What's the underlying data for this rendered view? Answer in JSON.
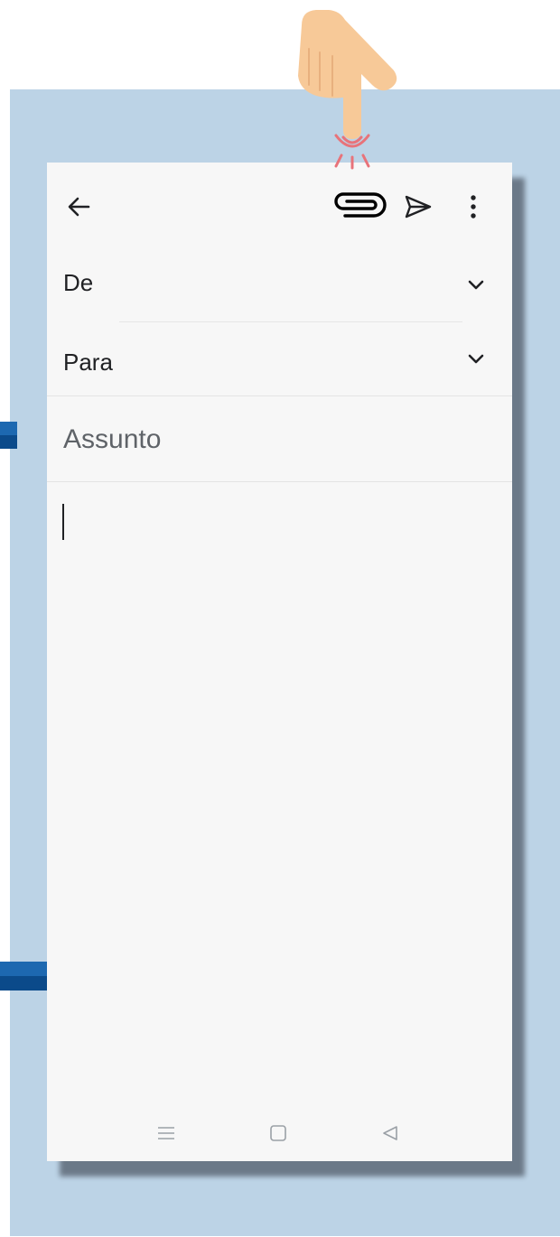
{
  "compose": {
    "from_label": "De",
    "to_label": "Para",
    "subject_placeholder": "Assunto",
    "body_text": ""
  },
  "toolbar": {
    "back_icon": "arrow-left-icon",
    "attach_icon": "paperclip-icon",
    "send_icon": "send-icon",
    "more_icon": "more-vertical-icon"
  },
  "system_nav": {
    "recents_icon": "menu-lines-icon",
    "home_icon": "square-icon",
    "back_icon": "triangle-back-icon"
  },
  "overlay": {
    "hint": "pointing-hand-icon",
    "highlighted_control": "attach"
  },
  "colors": {
    "backdrop": "#bcd3e6",
    "screen": "#f7f7f7",
    "text_primary": "#202124",
    "text_secondary": "#5f6368",
    "tap_highlight": "#e8737a",
    "hand_skin": "#f7c998",
    "edge_tab": "#1d68b0"
  }
}
